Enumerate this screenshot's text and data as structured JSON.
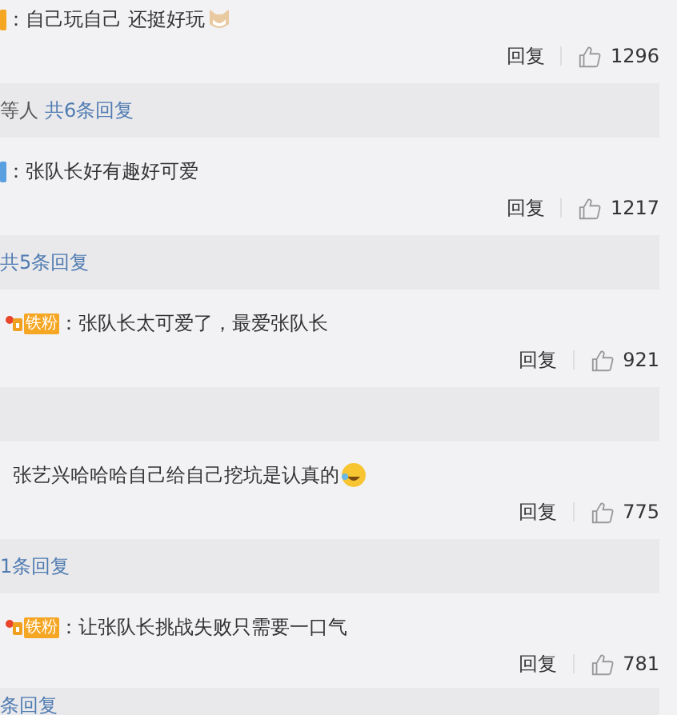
{
  "items": [
    {
      "kind": "comment",
      "badge": {
        "color": "#f5a623",
        "medal": false
      },
      "text": "：自己玩自己 还挺好玩",
      "emoji": {
        "kind": "cat"
      }
    },
    {
      "kind": "actions",
      "reply": "回复",
      "likes": "1296"
    },
    {
      "kind": "replies",
      "prefix": "等人",
      "link": "共6条回复"
    },
    {
      "kind": "comment",
      "badge": {
        "color": "#5aa0e0",
        "medal": false
      },
      "text": "：张队长好有趣好可爱"
    },
    {
      "kind": "actions",
      "reply": "回复",
      "likes": "1217"
    },
    {
      "kind": "replies",
      "link": "共5条回复"
    },
    {
      "kind": "comment",
      "badge": {
        "color": "#f5a623",
        "medal": true,
        "label": "铁粉"
      },
      "text": "：张队长太可爱了，最爱张队长"
    },
    {
      "kind": "actions",
      "reply": "回复",
      "likes": "921"
    },
    {
      "kind": "replies"
    },
    {
      "kind": "comment",
      "text": "张艺兴哈哈哈自己给自己挖坑是认真的",
      "emoji": {
        "kind": "laugh"
      }
    },
    {
      "kind": "actions",
      "reply": "回复",
      "likes": "775"
    },
    {
      "kind": "replies",
      "link": "1条回复"
    },
    {
      "kind": "comment",
      "badge": {
        "color": "#f5a623",
        "medal": true,
        "label": "铁粉"
      },
      "text": "：让张队长挑战失败只需要一口气"
    },
    {
      "kind": "actions",
      "reply": "回复",
      "likes": "781"
    },
    {
      "kind": "replies",
      "link": "条回复"
    }
  ]
}
